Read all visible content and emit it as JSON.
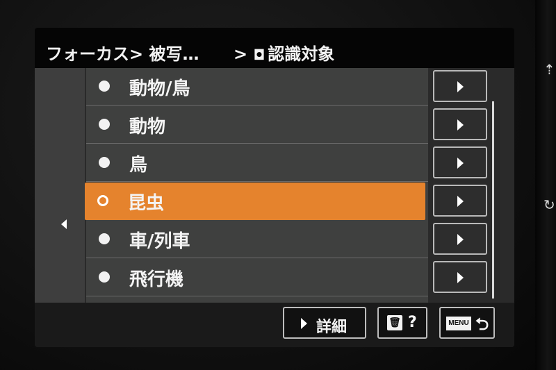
{
  "breadcrumb": {
    "part1": "フォーカス> 被写…",
    "part2": "> ",
    "part2_icon": "subject-recognition-icon",
    "part2_label": "認識対象"
  },
  "options": [
    {
      "label": "動物/鳥",
      "selected": false
    },
    {
      "label": "動物",
      "selected": false
    },
    {
      "label": "鳥",
      "selected": false
    },
    {
      "label": "昆虫",
      "selected": true
    },
    {
      "label": "車/列車",
      "selected": false
    },
    {
      "label": "飛行機",
      "selected": false
    }
  ],
  "footer": {
    "detail_label": "詳細",
    "help_label": "?",
    "menu_label": "MENU",
    "return_glyph": "⮌"
  },
  "colors": {
    "accent": "#e5832d",
    "list_bg": "#3f403f",
    "title_bg": "#050505"
  },
  "icons": {
    "back": "left-triangle-icon",
    "sub_item": "right-triangle-icon",
    "delete": "trash-icon",
    "return": "return-arrow-icon"
  }
}
